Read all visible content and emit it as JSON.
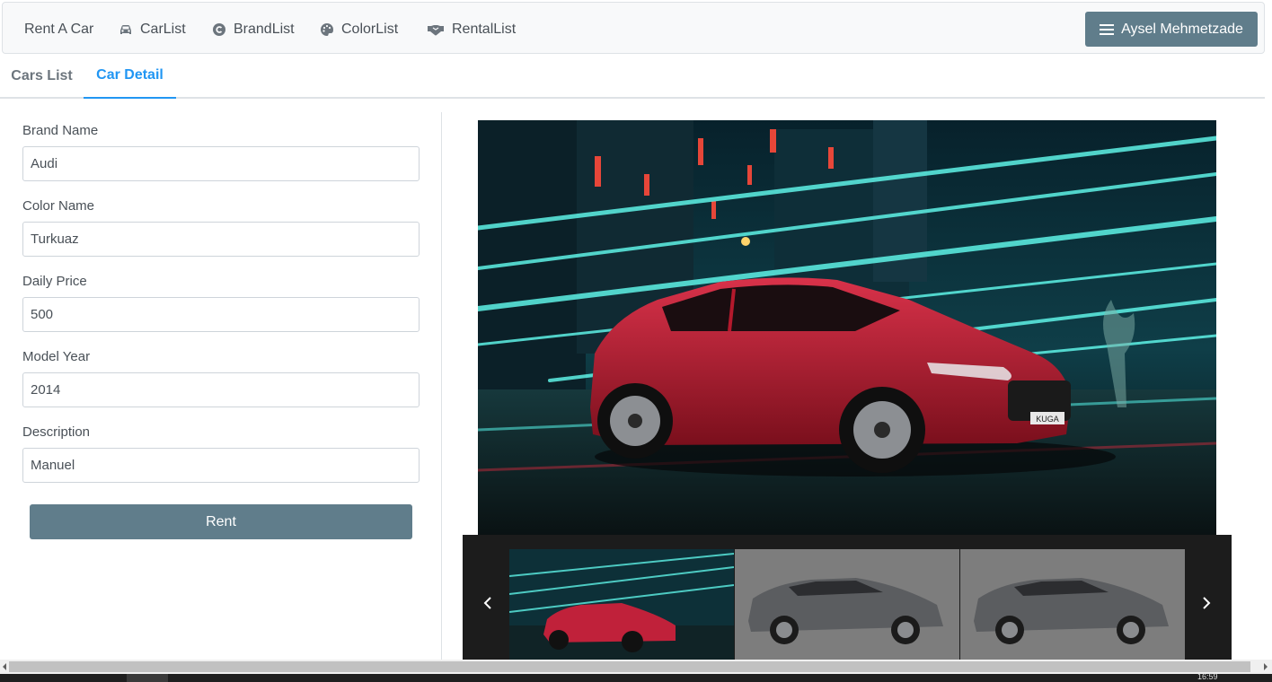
{
  "nav": {
    "brand": "Rent A Car",
    "items": [
      {
        "label": "CarList",
        "icon": "car-icon"
      },
      {
        "label": "BrandList",
        "icon": "copyright-icon"
      },
      {
        "label": "ColorList",
        "icon": "palette-icon"
      },
      {
        "label": "RentalList",
        "icon": "handshake-icon"
      }
    ],
    "user": "Aysel Mehmetzade"
  },
  "tabs": [
    {
      "label": "Cars List",
      "active": false
    },
    {
      "label": "Car Detail",
      "active": true
    }
  ],
  "form": {
    "fields": [
      {
        "label": "Brand Name",
        "value": "Audi"
      },
      {
        "label": "Color Name",
        "value": "Turkuaz"
      },
      {
        "label": "Daily Price",
        "value": "500"
      },
      {
        "label": "Model Year",
        "value": "2014"
      },
      {
        "label": "Description",
        "value": "Manuel"
      }
    ],
    "rent_label": "Rent"
  },
  "gallery": {
    "main_plate": "KUGA"
  },
  "taskbar": {
    "clock": "16:59"
  },
  "colors": {
    "accent": "#2196f3",
    "button": "#607d8b",
    "car_red": "#b3192c",
    "neon": "#22d3c8"
  }
}
